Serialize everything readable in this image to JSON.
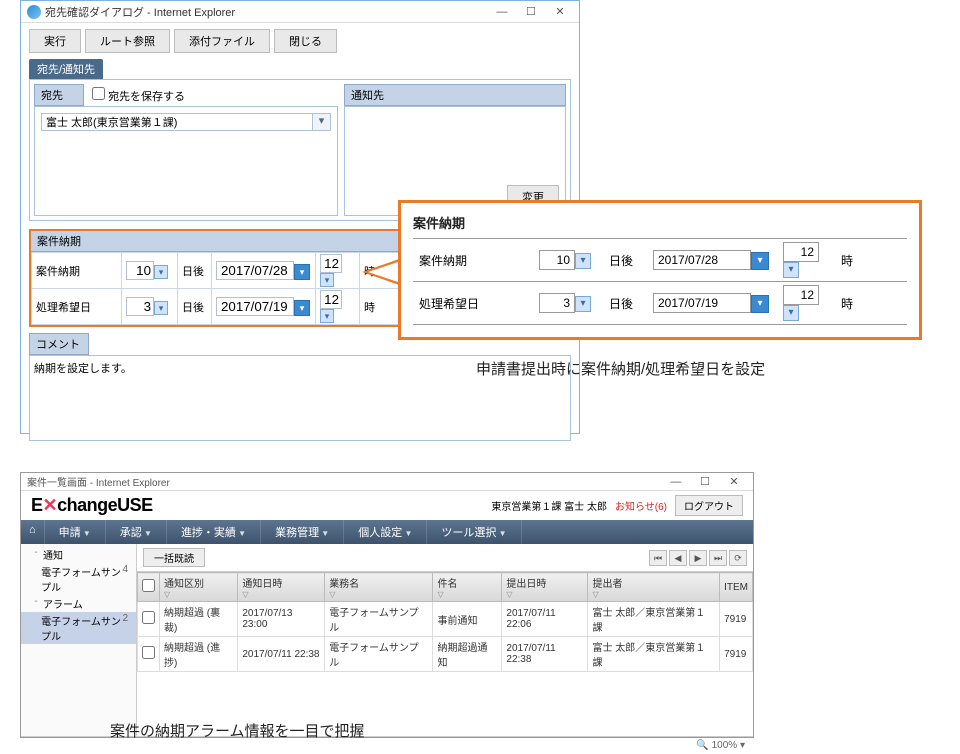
{
  "window1": {
    "title": "宛先確認ダイアログ - Internet Explorer",
    "toolbar": {
      "run": "実行",
      "route": "ルート参照",
      "attach": "添付ファイル",
      "close": "閉じる"
    },
    "tab": "宛先/通知先",
    "dest": {
      "header": "宛先",
      "save_label": "宛先を保存する",
      "value": "富士 太郎(東京営業第１課)"
    },
    "notice": {
      "header": "通知先",
      "change": "変更"
    },
    "deadline": {
      "header": "案件納期",
      "rows": [
        {
          "label": "案件納期",
          "num": "10",
          "days_after": "日後",
          "date": "2017/07/28",
          "hour": "12",
          "hour_unit": "時"
        },
        {
          "label": "処理希望日",
          "num": "3",
          "days_after": "日後",
          "date": "2017/07/19",
          "hour": "12",
          "hour_unit": "時"
        }
      ]
    },
    "comment": {
      "header": "コメント",
      "value": "納期を設定します。"
    }
  },
  "callout": {
    "title": "案件納期",
    "rows": [
      {
        "label": "案件納期",
        "num": "10",
        "days_after": "日後",
        "date": "2017/07/28",
        "hour": "12",
        "hour_unit": "時"
      },
      {
        "label": "処理希望日",
        "num": "3",
        "days_after": "日後",
        "date": "2017/07/19",
        "hour": "12",
        "hour_unit": "時"
      }
    ],
    "annotation": "申請書提出時に案件納期/処理希望日を設定"
  },
  "window2": {
    "title": "案件一覧画面 - Internet Explorer",
    "brand": "ExchangeUSE",
    "user_org": "東京営業第１課 富士 太郎",
    "notice": "お知らせ(6)",
    "logout": "ログアウト",
    "nav": [
      "申請",
      "承認",
      "進捗・実績",
      "業務管理",
      "個人設定",
      "ツール選択"
    ],
    "tree": [
      {
        "marker": "-",
        "label": "通知",
        "count": ""
      },
      {
        "marker": "",
        "label": "電子フォームサンプル",
        "count": "4"
      },
      {
        "marker": "-",
        "label": "アラーム",
        "count": ""
      },
      {
        "marker": "",
        "label": "電子フォームサンプル",
        "count": "2",
        "selected": true
      }
    ],
    "scan": "一括既読",
    "grid": {
      "headers": [
        "",
        "通知区別",
        "通知日時",
        "業務名",
        "件名",
        "提出日時",
        "提出者",
        "ITEM"
      ],
      "rows": [
        {
          "kind": "納期超過 (裏裁)",
          "notice_dt": "2017/07/13 23:00",
          "biz": "電子フォームサンプル",
          "subject": "事前通知",
          "submit_dt": "2017/07/11 22:06",
          "submitter": "富士 太郎／東京営業第１課",
          "item": "7919"
        },
        {
          "kind": "納期超過 (進捗)",
          "notice_dt": "2017/07/11 22:38",
          "biz": "電子フォームサンプル",
          "subject": "納期超過通知",
          "submit_dt": "2017/07/11 22:38",
          "submitter": "富士 太郎／東京営業第１課",
          "item": "7919"
        }
      ]
    },
    "zoom": "🔍 100% ▾",
    "annotation": "案件の納期アラーム情報を一目で把握"
  }
}
